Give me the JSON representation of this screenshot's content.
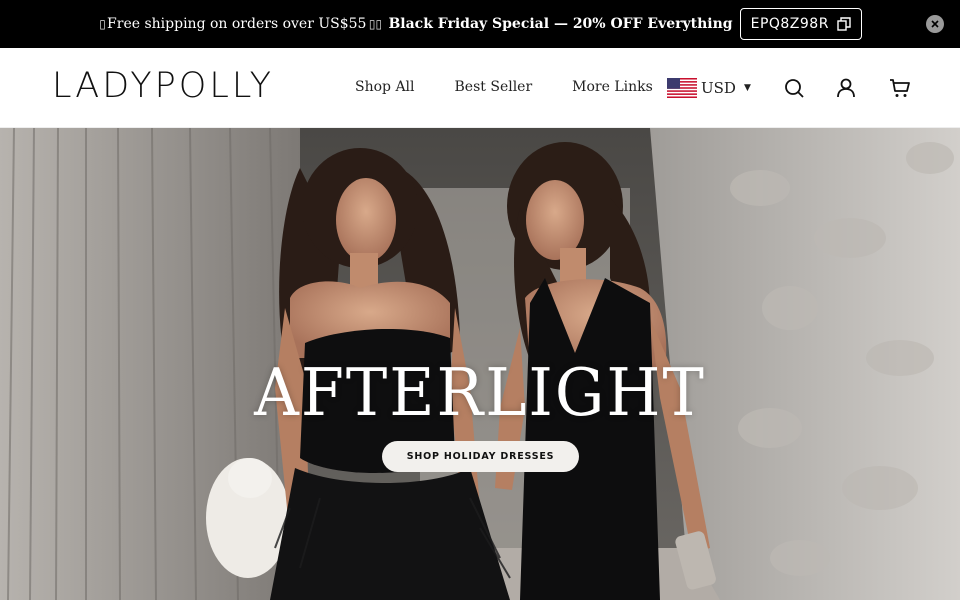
{
  "announcement": {
    "glyph_left": "▯",
    "shipping_text": "Free shipping on orders over US$55",
    "glyph_right": "▯▯",
    "promo_text": "Black Friday Special — 20% OFF Everything",
    "coupon_code": "EPQ8Z98R",
    "copy_icon": "copy-icon",
    "close_icon": "close-icon"
  },
  "header": {
    "logo": "LADYPOLLY",
    "nav": [
      "Shop All",
      "Best Seller",
      "More Links"
    ],
    "currency": {
      "code": "USD",
      "flag": "us-flag-icon"
    },
    "icons": [
      "search-icon",
      "account-icon",
      "cart-icon"
    ]
  },
  "hero": {
    "title": "AFTERLIGHT",
    "cta": "SHOP HOLIDAY DRESSES"
  },
  "colors": {
    "announcement_bg": "#000000",
    "header_bg": "#ffffff",
    "cta_bg": "#f2f0ed"
  }
}
